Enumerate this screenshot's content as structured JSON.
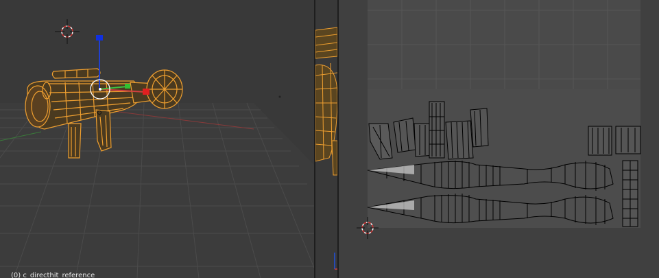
{
  "viewport3d": {
    "object_label": "(0) c_directhit_reference"
  },
  "colors": {
    "background": "#393939",
    "grid": "#4a4a4a",
    "uv_image_bg": "#4a4a4a",
    "selected_mesh": "#f0a030",
    "axis_x": "#d04040",
    "axis_y": "#40c040",
    "axis_z": "#2040d0",
    "uv_lines": "#000000"
  },
  "icons": [
    "3d-cursor-icon",
    "2d-cursor-icon",
    "transform-manipulator-icon"
  ]
}
